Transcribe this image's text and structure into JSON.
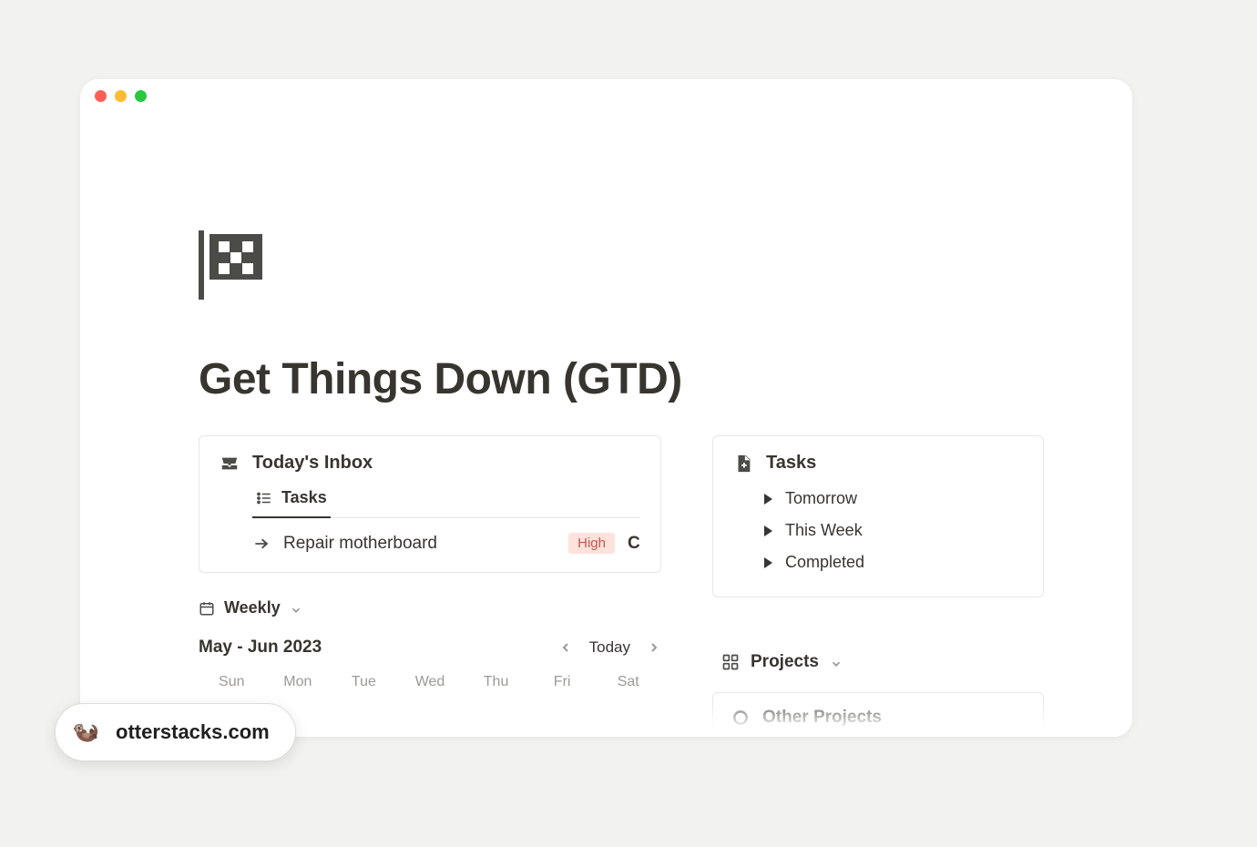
{
  "page": {
    "title": "Get Things Down (GTD)"
  },
  "inbox": {
    "header": "Today's Inbox",
    "tab_label": "Tasks",
    "task": {
      "name": "Repair motherboard",
      "priority": "High",
      "trailing_glyph": "C"
    }
  },
  "calendar": {
    "view_label": "Weekly",
    "range_label": "May - Jun 2023",
    "today_label": "Today",
    "days": [
      "Sun",
      "Mon",
      "Tue",
      "Wed",
      "Thu",
      "Fri",
      "Sat"
    ]
  },
  "tasks_card": {
    "header": "Tasks",
    "items": [
      "Tomorrow",
      "This Week",
      "Completed"
    ]
  },
  "projects": {
    "header": "Projects",
    "other_label": "Other Projects"
  },
  "brand": {
    "label": "otterstacks.com",
    "emoji": "🦦"
  }
}
